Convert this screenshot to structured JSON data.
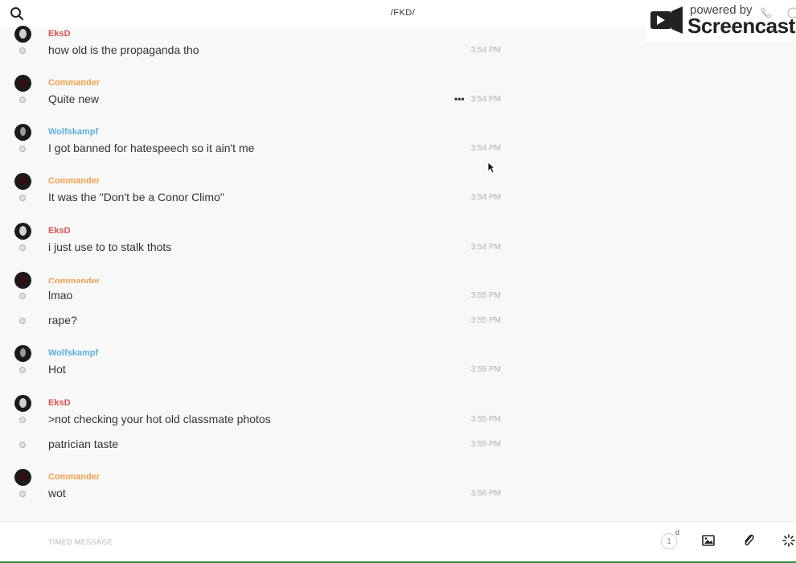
{
  "header": {
    "title": "/FKD/"
  },
  "watermark": {
    "line1": "powered by",
    "line2": "Screencastify"
  },
  "messages": [
    {
      "user": "EksD",
      "avatar": "pale",
      "lines": [
        {
          "text": "how old is the propaganda tho",
          "time": "3:54 PM"
        }
      ]
    },
    {
      "user": "Commander",
      "avatar": "red",
      "lines": [
        {
          "text": "Quite new",
          "time": "3:54 PM",
          "more": "•••"
        }
      ]
    },
    {
      "user": "Wolfskampf",
      "avatar": "mid",
      "lines": [
        {
          "text": "I got banned for hatespeech so it ain't me",
          "time": "3:54 PM"
        }
      ]
    },
    {
      "user": "Commander",
      "avatar": "red",
      "lines": [
        {
          "text": "It was the \"Don't be a Conor Climo\"",
          "time": "3:54 PM"
        }
      ]
    },
    {
      "user": "EksD",
      "avatar": "pale",
      "lines": [
        {
          "text": "i just use to to stalk thots",
          "time": "3:54 PM"
        }
      ]
    },
    {
      "user": "Commander",
      "avatar": "red",
      "lines": [
        {
          "text": "lmao",
          "time": "3:55 PM"
        },
        {
          "text": "rape?",
          "time": "3:55 PM"
        }
      ]
    },
    {
      "user": "Wolfskampf",
      "avatar": "mid",
      "lines": [
        {
          "text": "Hot",
          "time": "3:55 PM"
        }
      ]
    },
    {
      "user": "EksD",
      "avatar": "pale",
      "lines": [
        {
          "text": ">not checking your hot old classmate photos",
          "time": "3:55 PM"
        },
        {
          "text": "patrician taste",
          "time": "3:55 PM"
        }
      ]
    },
    {
      "user": "Commander",
      "avatar": "red",
      "lines": [
        {
          "text": "wot",
          "time": "3:56 PM"
        }
      ]
    }
  ],
  "composer": {
    "placeholder": "TIMED MESSAGE",
    "timer_value": "1",
    "timer_unit": "d"
  },
  "colors": {
    "EksD": "#d9534f",
    "Commander": "#f0a04b",
    "Wolfskampf": "#5bb0e0",
    "bottom_accent": "#2e8b3d"
  }
}
